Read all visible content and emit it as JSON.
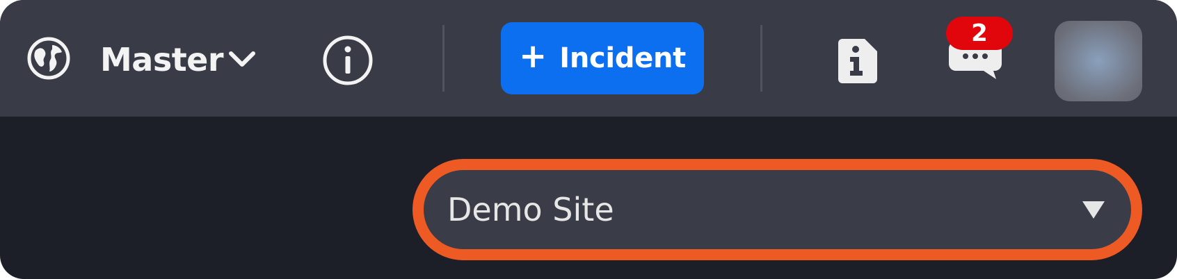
{
  "topbar": {
    "workspace_label": "Master",
    "incident_button": {
      "icon": "+",
      "label": "Incident"
    },
    "notifications_badge": "2",
    "icons": {
      "globe": "globe-icon",
      "workspace_dropdown": "chevron-down-icon",
      "info": "info-circle-icon",
      "about": "file-info-icon",
      "messages": "chat-dots-icon",
      "avatar": "user-avatar"
    }
  },
  "site_selector": {
    "value": "Demo Site",
    "icon": "caret-down-icon"
  },
  "colors": {
    "topbar_bg": "#393c46",
    "page_bg": "#1c1f27",
    "accent": "#0b6ff0",
    "badge": "#e0060c",
    "highlight": "#ee5a24"
  }
}
